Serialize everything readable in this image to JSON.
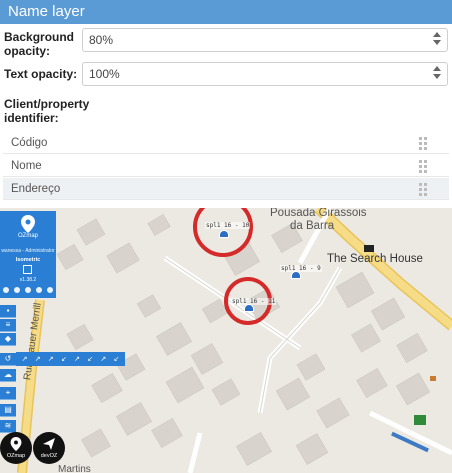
{
  "panel": {
    "title": "Name layer",
    "background_opacity": {
      "label_line1": "Background",
      "label_line2": "opacity:",
      "value": "80%"
    },
    "text_opacity": {
      "label": "Text opacity:",
      "value": "100%"
    },
    "identifier": {
      "label_line1": "Client/property",
      "label_line2": "identifier:"
    },
    "fields": [
      "Código",
      "Nome",
      "Endereço"
    ]
  },
  "map": {
    "labels": {
      "pousada_line1": "Pousada Girassois",
      "pousada_line2": "da Barra",
      "search_house": "The Search House",
      "street_left": "Rua Bauer Merrill",
      "street_bottom": "Martins"
    },
    "markers": [
      "spl1 16 - 10",
      "spl1 16 - 9",
      "spl1 16 - 11"
    ],
    "highlight_color": "#d42a2a",
    "marker_color": "#2b6cc4"
  },
  "app": {
    "brand": "OZmap",
    "user": "wanessa - Administrator",
    "mode": "Isometric",
    "version": "v1.38.2",
    "logos": [
      "OZmap",
      "devOZ"
    ],
    "accent": "#2a7fd4"
  }
}
